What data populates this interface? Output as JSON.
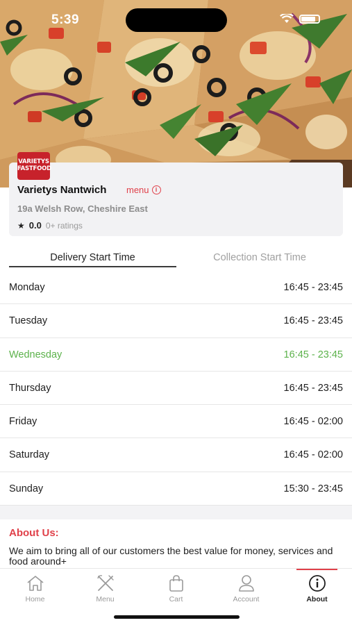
{
  "status_bar": {
    "time": "5:39"
  },
  "restaurant": {
    "logo_text_line1": "VARIETYS",
    "logo_text_line2": "FASTFOOD",
    "name": "Varietys Nantwich",
    "menu_link": "menu",
    "address": "19a Welsh Row, Cheshire East",
    "rating_value": "0.0",
    "rating_count": "0+ ratings"
  },
  "tabs": {
    "delivery": "Delivery Start Time",
    "collection": "Collection Start Time",
    "active": "delivery"
  },
  "hours": [
    {
      "day": "Monday",
      "time": "16:45 - 23:45",
      "today": false
    },
    {
      "day": "Tuesday",
      "time": "16:45 - 23:45",
      "today": false
    },
    {
      "day": "Wednesday",
      "time": "16:45 - 23:45",
      "today": true
    },
    {
      "day": "Thursday",
      "time": "16:45 - 23:45",
      "today": false
    },
    {
      "day": "Friday",
      "time": "16:45 - 02:00",
      "today": false
    },
    {
      "day": "Saturday",
      "time": "16:45 - 02:00",
      "today": false
    },
    {
      "day": "Sunday",
      "time": "15:30 - 23:45",
      "today": false
    }
  ],
  "about": {
    "title": "About Us:",
    "text": "We aim to bring all of our customers the best value for money, services and food around+"
  },
  "nav": [
    {
      "label": "Home",
      "icon": "home-icon",
      "active": false
    },
    {
      "label": "Menu",
      "icon": "fork-knife-icon",
      "active": false
    },
    {
      "label": "Cart",
      "icon": "shopping-bag-icon",
      "active": false
    },
    {
      "label": "Account",
      "icon": "user-icon",
      "active": false
    },
    {
      "label": "About",
      "icon": "info-icon",
      "active": true
    }
  ],
  "colors": {
    "accent": "#e0414a",
    "today": "#5cb24b",
    "logo_bg": "#c7222b"
  }
}
